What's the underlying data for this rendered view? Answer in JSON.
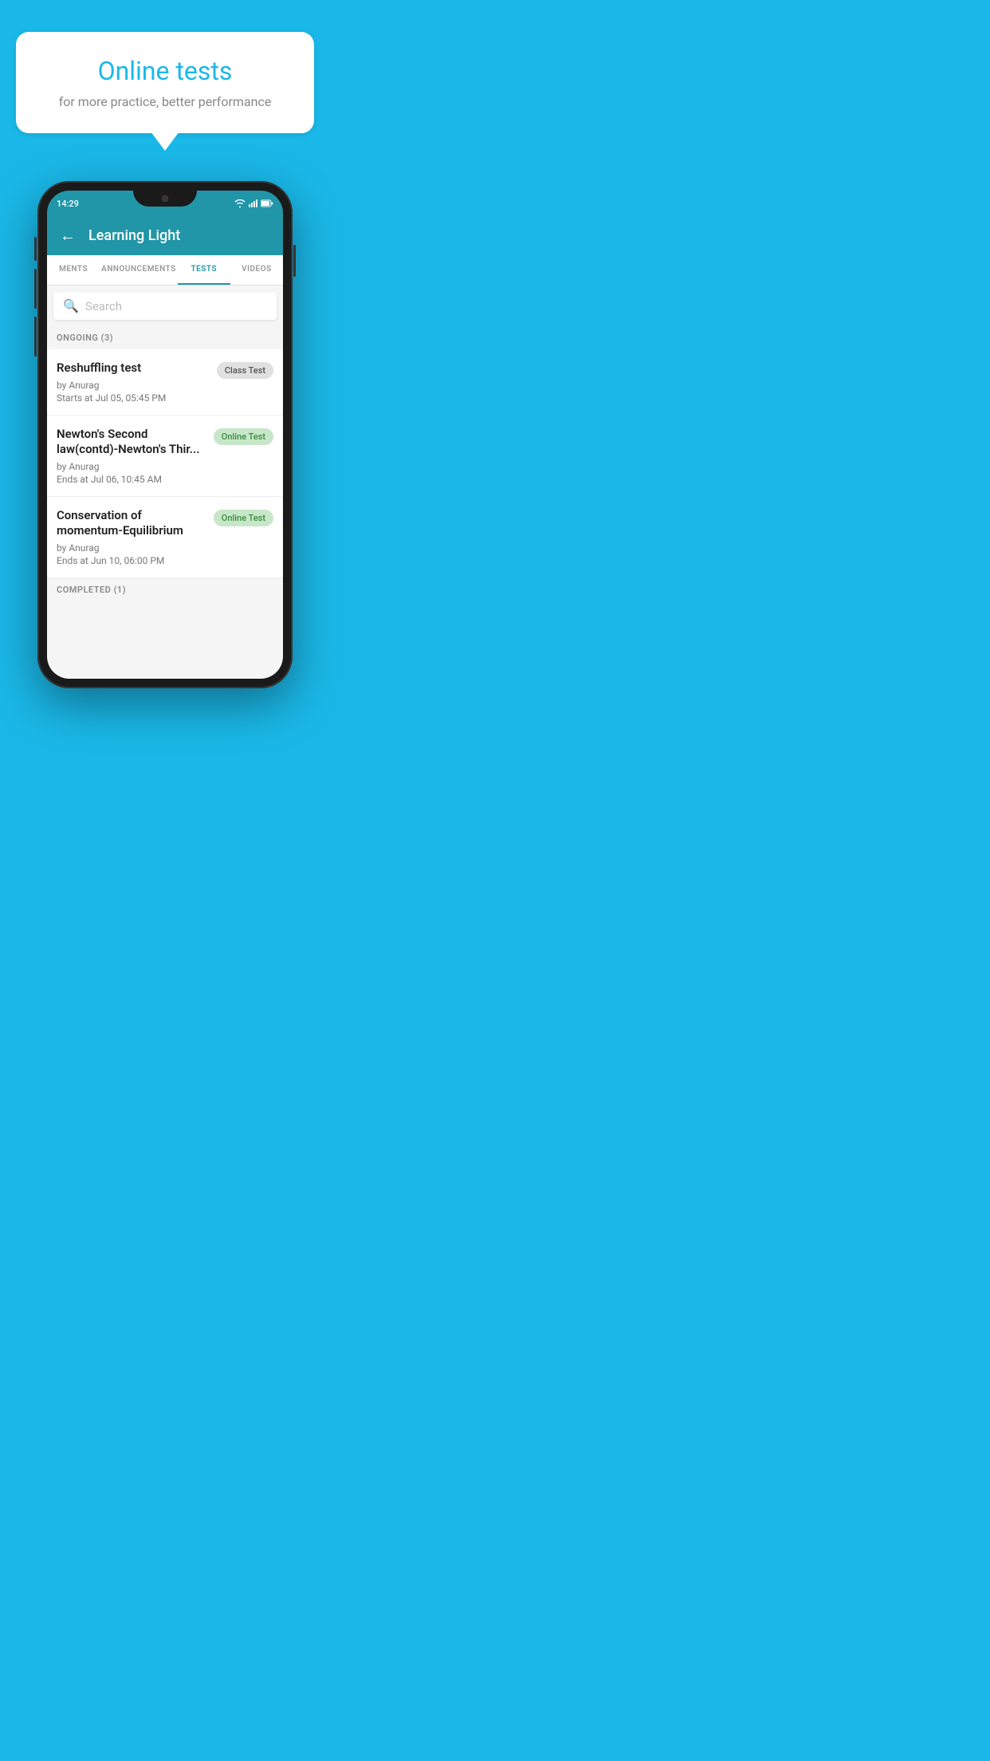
{
  "background_color": "#1ab8e8",
  "hero": {
    "bubble_title": "Online tests",
    "bubble_subtitle": "for more practice, better performance"
  },
  "phone": {
    "status_bar": {
      "time": "14:29"
    },
    "app_header": {
      "title": "Learning Light"
    },
    "tabs": [
      {
        "label": "MENTS",
        "active": false
      },
      {
        "label": "ANNOUNCEMENTS",
        "active": false
      },
      {
        "label": "TESTS",
        "active": true
      },
      {
        "label": "VIDEOS",
        "active": false
      }
    ],
    "search": {
      "placeholder": "Search"
    },
    "ongoing_section": {
      "label": "ONGOING (3)"
    },
    "tests": [
      {
        "name": "Reshuffling test",
        "author": "by Anurag",
        "time_label": "Starts at",
        "time": "Jul 05, 05:45 PM",
        "badge": "Class Test",
        "badge_type": "gray"
      },
      {
        "name": "Newton's Second law(contd)-Newton's Thir...",
        "author": "by Anurag",
        "time_label": "Ends at",
        "time": "Jul 06, 10:45 AM",
        "badge": "Online Test",
        "badge_type": "green"
      },
      {
        "name": "Conservation of momentum-Equilibrium",
        "author": "by Anurag",
        "time_label": "Ends at",
        "time": "Jun 10, 06:00 PM",
        "badge": "Online Test",
        "badge_type": "green"
      }
    ],
    "completed_section": {
      "label": "COMPLETED (1)"
    }
  }
}
